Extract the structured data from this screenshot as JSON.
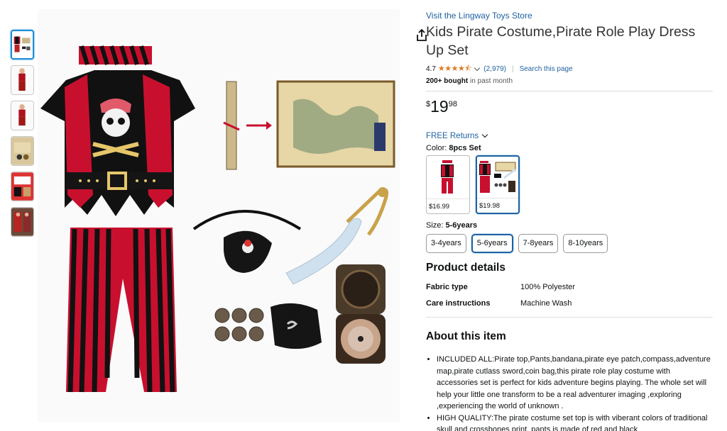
{
  "thumbnails": [
    {
      "name": "thumb-main-set"
    },
    {
      "name": "thumb-kid-1"
    },
    {
      "name": "thumb-kid-2"
    },
    {
      "name": "thumb-accessories"
    },
    {
      "name": "thumb-detail"
    },
    {
      "name": "thumb-lifestyle"
    }
  ],
  "product": {
    "store_link": "Visit the Lingway Toys Store",
    "title": "Kids Pirate Costume,Pirate Role Play Dress Up Set",
    "rating": "4.7",
    "stars": "★★★★⯪",
    "rating_count": "(2,979)",
    "search_page": "Search this page",
    "bought_bold": "200+ bought",
    "bought_rest": " in past month",
    "price_currency": "$",
    "price_whole": "19",
    "price_fraction": "98",
    "returns": "FREE Returns",
    "color_label": "Color: ",
    "color_value": "8pcs Set",
    "swatches": [
      {
        "price": "$16.99",
        "selected": false
      },
      {
        "price": "$19.98",
        "selected": true
      }
    ],
    "size_label": "Size: ",
    "size_value": "5-6years",
    "sizes": [
      "3-4years",
      "5-6years",
      "7-8years",
      "8-10years"
    ],
    "selected_size": "5-6years"
  },
  "details": {
    "heading": "Product details",
    "rows": [
      {
        "key": "Fabric type",
        "value": "100% Polyester"
      },
      {
        "key": "Care instructions",
        "value": "Machine Wash"
      }
    ]
  },
  "about": {
    "heading": "About this item",
    "bullets": [
      "INCLUDED ALL:Pirate top,Pants,bandana,pirate eye patch,compass,adventure map,pirate cutlass sword,coin bag,this pirate role play costume with accessories set is perfect for kids adventure begins playing. The whole set will help your little one transform to be a real adventurer imaging ,exploring ,experiencing the world of unknown .",
      "HIGH QUALITY:The pirate costume set top is with viberant colors of traditional skull and crossbones print, pants is made of red and black"
    ]
  },
  "colors": {
    "link": "#2162a1",
    "star": "#de7921",
    "selected_border": "#2162a1"
  }
}
